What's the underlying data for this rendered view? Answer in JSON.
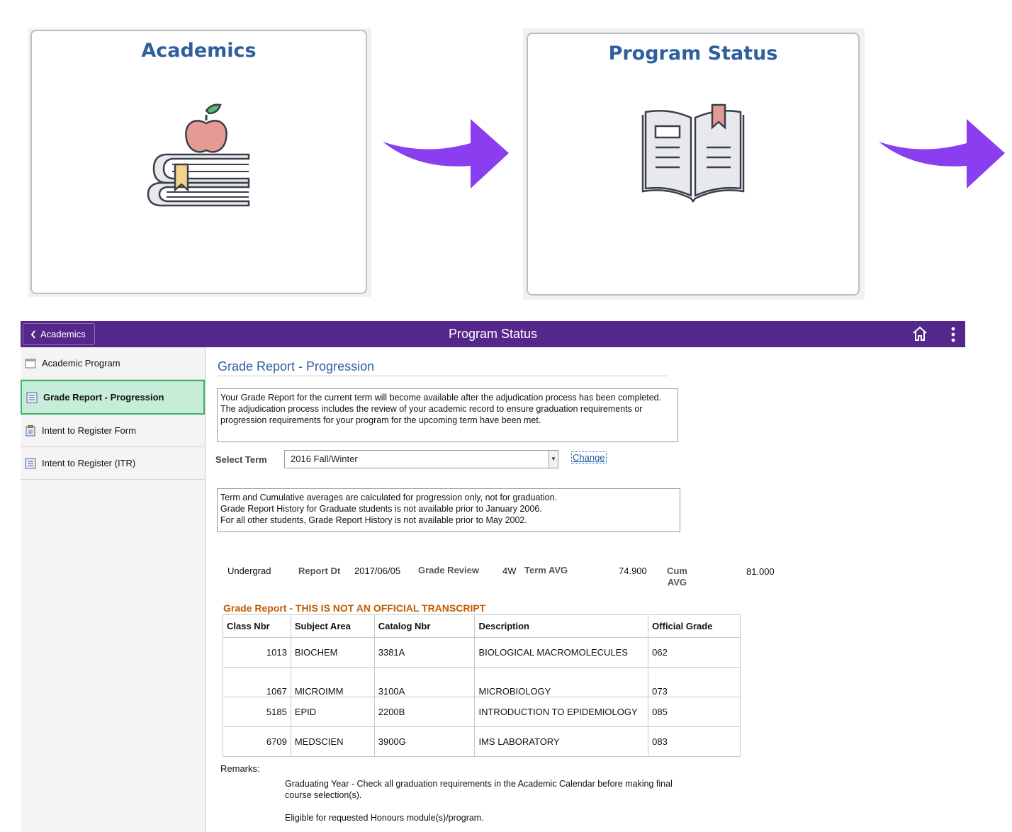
{
  "tiles": [
    {
      "title": "Academics",
      "icon": "apple-books-icon"
    },
    {
      "title": "Program Status",
      "icon": "open-book-icon"
    }
  ],
  "colors": {
    "banner": "#54278b",
    "arrow": "#8b3ef0",
    "tile_title": "#2f5f9e",
    "active_item": "#c7ecd7",
    "caption": "#c25a00"
  },
  "banner": {
    "back_label": "Academics",
    "title": "Program Status"
  },
  "sidebar": {
    "items": [
      {
        "label": "Academic Program",
        "icon": "window-icon"
      },
      {
        "label": "Grade Report - Progression",
        "icon": "list-icon",
        "active": true
      },
      {
        "label": "Intent to Register Form",
        "icon": "clipboard-icon"
      },
      {
        "label": "Intent to Register (ITR)",
        "icon": "list-icon"
      }
    ]
  },
  "content": {
    "title": "Grade Report - Progression",
    "notice1": "Your Grade Report for the current term will become available after the adjudication process has been completed. The adjudication process includes the review of your academic record to ensure graduation requirements or progression requirements for your program for the upcoming term have been met.",
    "select_label": "Select Term",
    "select_value": "2016 Fall/Winter",
    "change_label": "Change",
    "notice2_lines": [
      "Term and Cumulative averages are calculated for progression only, not for graduation.",
      "Grade Report History for Graduate students is not available prior to January 2006.",
      "For all other students, Grade Report History is not available prior to May 2002."
    ],
    "info": {
      "career": "Undergrad",
      "report_dt_label": "Report Dt",
      "report_dt": "2017/06/05",
      "grade_review_label": "Grade Review",
      "grade_review": "4W",
      "term_avg_label": "Term AVG",
      "term_avg": "74.900",
      "cum_label": "Cum",
      "cum_label2": "AVG",
      "cum_avg": "81.000"
    },
    "grade_caption": "Grade Report - THIS IS NOT AN OFFICIAL TRANSCRIPT",
    "table": {
      "headers": [
        "Class Nbr",
        "Subject Area",
        "Catalog Nbr",
        "Description",
        "Official Grade"
      ],
      "rows": [
        [
          "1013",
          "BIOCHEM",
          "3381A",
          "BIOLOGICAL MACROMOLECULES",
          "062"
        ],
        [
          "1067",
          "MICROIMM",
          "3100A",
          "MICROBIOLOGY",
          "073"
        ],
        [
          "5185",
          "EPID",
          "2200B",
          "INTRODUCTION TO EPIDEMIOLOGY",
          "085"
        ],
        [
          "6709",
          "MEDSCIEN",
          "3900G",
          "IMS LABORATORY",
          "083"
        ]
      ]
    },
    "remarks_label": "Remarks:",
    "remarks": [
      "Graduating Year - Check all graduation requirements in the Academic Calendar before making final course selection(s).",
      "Eligible for requested Honours module(s)/program."
    ]
  }
}
